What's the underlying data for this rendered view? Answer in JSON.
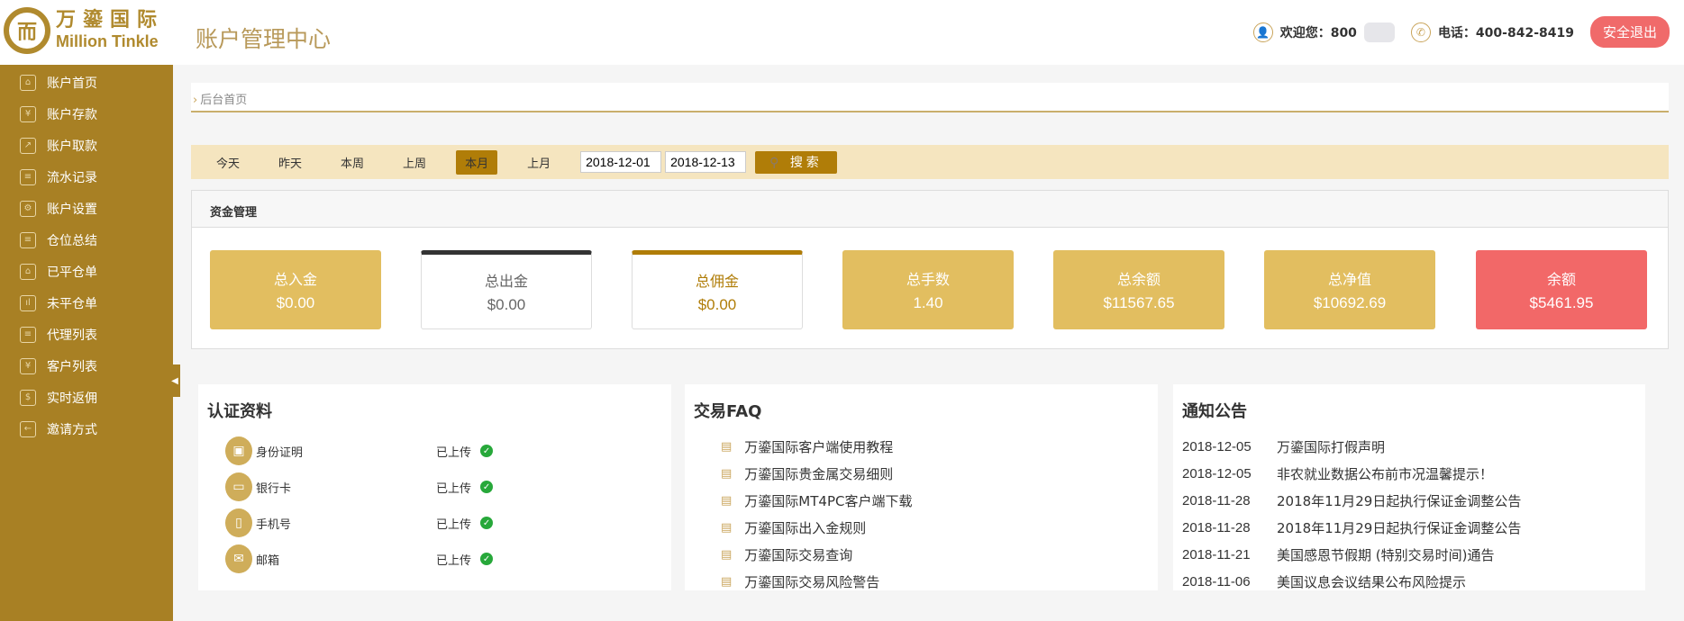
{
  "header": {
    "logo_cn": "万鎏国际",
    "logo_en": "Million Tinkle",
    "title": "账户管理中心",
    "welcome": "欢迎您：800",
    "phone": "电话：400-842-8419",
    "logout": "安全退出"
  },
  "sidebar": {
    "items": [
      {
        "label": "账户首页",
        "icon": "home-icon",
        "glyph": "⌂"
      },
      {
        "label": "账户存款",
        "icon": "deposit-icon",
        "glyph": "¥"
      },
      {
        "label": "账户取款",
        "icon": "withdraw-icon",
        "glyph": "↗"
      },
      {
        "label": "流水记录",
        "icon": "clipboard-icon",
        "glyph": "≡"
      },
      {
        "label": "账户设置",
        "icon": "gear-icon",
        "glyph": "⚙"
      },
      {
        "label": "仓位总结",
        "icon": "summary-icon",
        "glyph": "≡"
      },
      {
        "label": "已平仓单",
        "icon": "bank-icon",
        "glyph": "⌂"
      },
      {
        "label": "未平仓单",
        "icon": "chart-icon",
        "glyph": "ıl"
      },
      {
        "label": "代理列表",
        "icon": "list-icon",
        "glyph": "≡"
      },
      {
        "label": "客户列表",
        "icon": "customer-icon",
        "glyph": "¥"
      },
      {
        "label": "实时返佣",
        "icon": "rebate-icon",
        "glyph": "$"
      },
      {
        "label": "邀请方式",
        "icon": "invite-icon",
        "glyph": "←"
      }
    ]
  },
  "breadcrumb": "后台首页",
  "filter": {
    "tabs": [
      "今天",
      "昨天",
      "本周",
      "上周",
      "本月",
      "上月"
    ],
    "active": "本月",
    "start_date": "2018-12-01",
    "end_date": "2018-12-13",
    "search": "搜索"
  },
  "fund": {
    "title": "资金管理",
    "cards": [
      {
        "label": "总入金",
        "value": "$0.00"
      },
      {
        "label": "总出金",
        "value": "$0.00"
      },
      {
        "label": "总佣金",
        "value": "$0.00"
      },
      {
        "label": "总手数",
        "value": "1.40"
      },
      {
        "label": "总余额",
        "value": "$11567.65"
      },
      {
        "label": "总净值",
        "value": "$10692.69"
      },
      {
        "label": "余额",
        "value": "$5461.95"
      }
    ]
  },
  "cert": {
    "title": "认证资料",
    "items": [
      {
        "name": "身份证明",
        "status": "已上传"
      },
      {
        "name": "银行卡",
        "status": "已上传"
      },
      {
        "name": "手机号",
        "status": "已上传"
      },
      {
        "name": "邮箱",
        "status": "已上传"
      }
    ]
  },
  "faq": {
    "title": "交易FAQ",
    "items": [
      "万鎏国际客户端使用教程",
      "万鎏国际贵金属交易细则",
      "万鎏国际MT4PC客户端下载",
      "万鎏国际出入金规则",
      "万鎏国际交易查询",
      "万鎏国际交易风险警告"
    ]
  },
  "notice": {
    "title": "通知公告",
    "items": [
      {
        "date": "2018-12-05",
        "text": "万鎏国际打假声明"
      },
      {
        "date": "2018-12-05",
        "text": "非农就业数据公布前市况温馨提示！"
      },
      {
        "date": "2018-11-28",
        "text": "2018年11月29日起执行保证金调整公告"
      },
      {
        "date": "2018-11-28",
        "text": "2018年11月29日起执行保证金调整公告"
      },
      {
        "date": "2018-11-21",
        "text": "美国感恩节假期 (特别交易时间)通告"
      },
      {
        "date": "2018-11-06",
        "text": "美国议息会议结果公布风险提示"
      }
    ]
  }
}
